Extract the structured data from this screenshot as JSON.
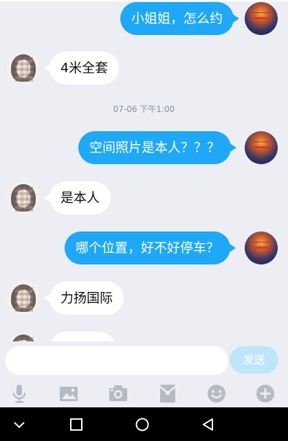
{
  "messages": [
    {
      "side": "me",
      "text": "小姐姐，怎么约"
    },
    {
      "side": "other",
      "text": "4米全套"
    },
    {
      "side": "me",
      "text": "空间照片是本人？？？"
    },
    {
      "side": "other",
      "text": "是本人"
    },
    {
      "side": "me",
      "text": "哪个位置，好不好停车？"
    },
    {
      "side": "other",
      "text": "力扬国际"
    }
  ],
  "timestamp": "07-06 下午1:00",
  "composer": {
    "placeholder": "",
    "send_label": "发送"
  },
  "toolbar": {
    "icons": [
      "microphone-icon",
      "image-icon",
      "camera-icon",
      "red-packet-icon",
      "emoji-icon",
      "plus-icon"
    ]
  },
  "navbar": {
    "icons": [
      "chevron-down-icon",
      "recents-icon",
      "home-icon",
      "back-icon"
    ]
  },
  "colors": {
    "sent_bubble": "#1fa8f5",
    "received_bubble": "#ffffff",
    "background": "#eceef4",
    "send_button": "#bfe5fb"
  }
}
